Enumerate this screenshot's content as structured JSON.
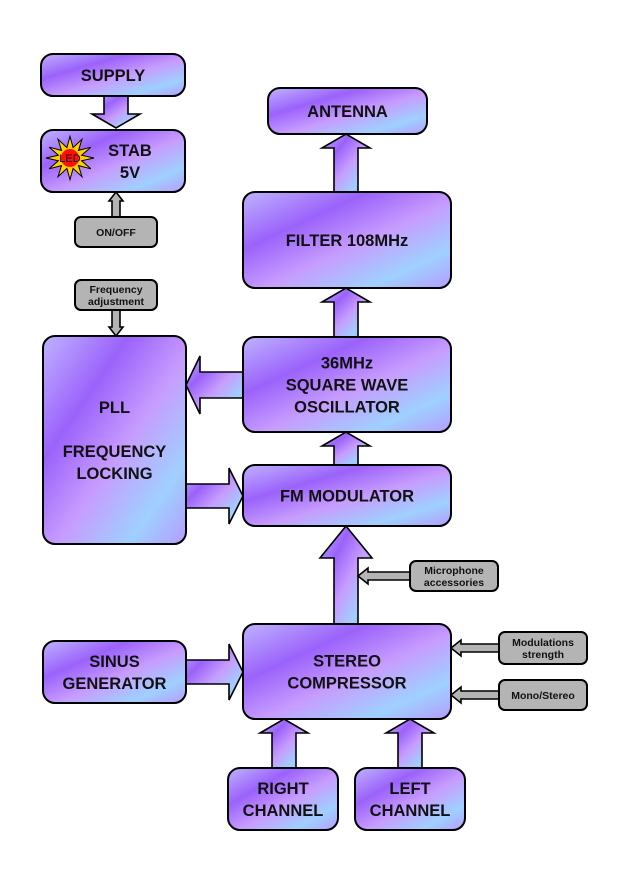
{
  "colors": {
    "gradient": [
      "#bfb2ff",
      "#9b62fb",
      "#c79cff",
      "#9fd0ff",
      "#a880ff"
    ],
    "control_fill": "#b4b4b4",
    "stroke": "#000000"
  },
  "blocks": {
    "supply": [
      "SUPPLY"
    ],
    "stab": [
      "STAB",
      "5V"
    ],
    "led": "LED",
    "antenna": [
      "ANTENNA"
    ],
    "filter": [
      "FILTER 108MHz"
    ],
    "pll": [
      "PLL",
      "",
      "FREQUENCY",
      "LOCKING"
    ],
    "oscillator": [
      "36MHz",
      "SQUARE WAVE",
      "OSCILLATOR"
    ],
    "fm_modulator": [
      "FM MODULATOR"
    ],
    "sinus": [
      "SINUS",
      "GENERATOR"
    ],
    "stereo": [
      "STEREO",
      "COMPRESSOR"
    ],
    "right": [
      "RIGHT",
      "CHANNEL"
    ],
    "left": [
      "LEFT",
      "CHANNEL"
    ]
  },
  "controls": {
    "onoff": [
      "ON/OFF"
    ],
    "freq_adj": [
      "Frequency",
      "adjustment"
    ],
    "microphone": [
      "Microphone",
      "accessories"
    ],
    "mod_strength": [
      "Modulations",
      "strength"
    ],
    "mono_stereo": [
      "Mono/Stereo"
    ]
  }
}
